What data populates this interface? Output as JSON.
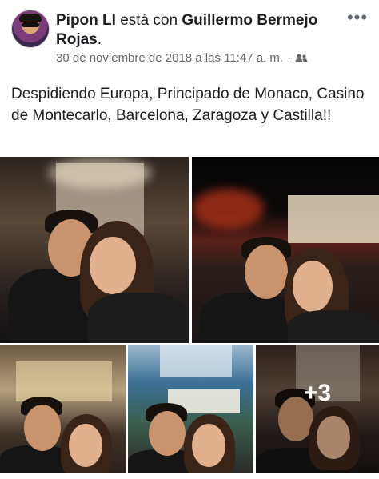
{
  "post": {
    "author_name": "Pipon LI",
    "connector": " está con ",
    "tagged_name": "Guillermo Bermejo Rojas",
    "tagged_suffix": ".",
    "timestamp": "30 de noviembre de 2018 a las 11:47 a. m.",
    "separator": "·",
    "audience_icon": "friends-icon",
    "more_icon": "more-options-icon",
    "text": "Despidiendo Europa, Principado de Monaco, Casino de Montecarlo, Barcelona, Zaragoza y Castilla!!",
    "photos_more_label": "+3"
  }
}
